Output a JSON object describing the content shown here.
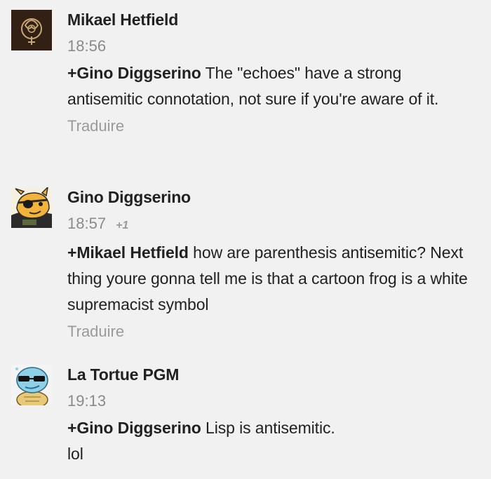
{
  "comments": [
    {
      "author": "Mikael Hetfield",
      "time": "18:56",
      "mention": "+Gino Diggserino",
      "text": " The \"echoes\" have a strong antisemitic connotation, not sure if you're aware of it.",
      "translate": "Traduire"
    },
    {
      "author": "Gino Diggserino",
      "time": "18:57",
      "plus_one": "+1",
      "mention": "+Mikael Hetfield",
      "text": " how are parenthesis antisemitic? Next thing youre gonna tell me is that a cartoon frog is a white supremacist symbol",
      "translate": "Traduire"
    },
    {
      "author": "La Tortue PGM",
      "time": "19:13",
      "mention": "+Gino Diggserino",
      "text": " Lisp is antisemitic.",
      "text_line2": "lol"
    }
  ]
}
